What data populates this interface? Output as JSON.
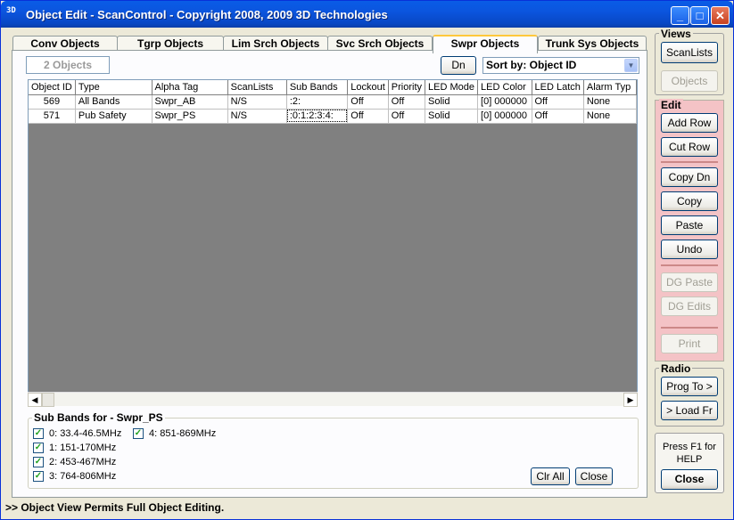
{
  "window": {
    "title": "Object Edit - ScanControl - Copyright 2008, 2009 3D Technologies",
    "app_icon_text": "3D"
  },
  "tabs": [
    {
      "label": "Conv Objects"
    },
    {
      "label": "Tgrp Objects"
    },
    {
      "label": "Lim Srch Objects"
    },
    {
      "label": "Svc Srch Objects"
    },
    {
      "label": "Swpr Objects",
      "active": true
    },
    {
      "label": "Trunk Sys Objects"
    }
  ],
  "toolbar": {
    "count": "2 Objects",
    "dn_label": "Dn",
    "sort_value": "Sort by: Object ID"
  },
  "grid": {
    "columns": [
      "Object ID",
      "Type",
      "Alpha Tag",
      "ScanLists",
      "Sub Bands",
      "Lockout",
      "Priority",
      "LED Mode",
      "LED Color",
      "LED Latch",
      "Alarm Typ"
    ],
    "rows": [
      [
        "569",
        "All Bands",
        "Swpr_AB",
        "N/S",
        ":2:",
        "Off",
        "Off",
        "Solid",
        "[0] 000000",
        "Off",
        "None"
      ],
      [
        "571",
        "Pub Safety",
        "Swpr_PS",
        "N/S",
        ":0:1:2:3:4:",
        "Off",
        "Off",
        "Solid",
        "[0] 000000",
        "Off",
        "None"
      ]
    ]
  },
  "subbands": {
    "title": "Sub Bands for - Swpr_PS",
    "items": [
      {
        "label": "0: 33.4-46.5MHz",
        "checked": true
      },
      {
        "label": "1: 151-170MHz",
        "checked": true
      },
      {
        "label": "2: 453-467MHz",
        "checked": true
      },
      {
        "label": "3: 764-806MHz",
        "checked": true
      },
      {
        "label": "4: 851-869MHz",
        "checked": true
      }
    ],
    "clr_all_label": "Clr All",
    "close_label": "Close"
  },
  "views": {
    "title": "Views",
    "scanlists_label": "ScanLists",
    "objects_label": "Objects"
  },
  "edit": {
    "title": "Edit",
    "add_row": "Add Row",
    "cut_row": "Cut Row",
    "copy_dn": "Copy Dn",
    "copy": "Copy",
    "paste": "Paste",
    "undo": "Undo",
    "dg_paste": "DG Paste",
    "dg_edits": "DG Edits",
    "print": "Print"
  },
  "radio": {
    "title": "Radio",
    "prog_to": "Prog To >",
    "load_fr": "> Load Fr"
  },
  "help": {
    "text_line1": "Press F1 for",
    "text_line2": "HELP",
    "close_label": "Close"
  },
  "status": {
    "text": ">> Object View Permits Full Object Editing."
  }
}
